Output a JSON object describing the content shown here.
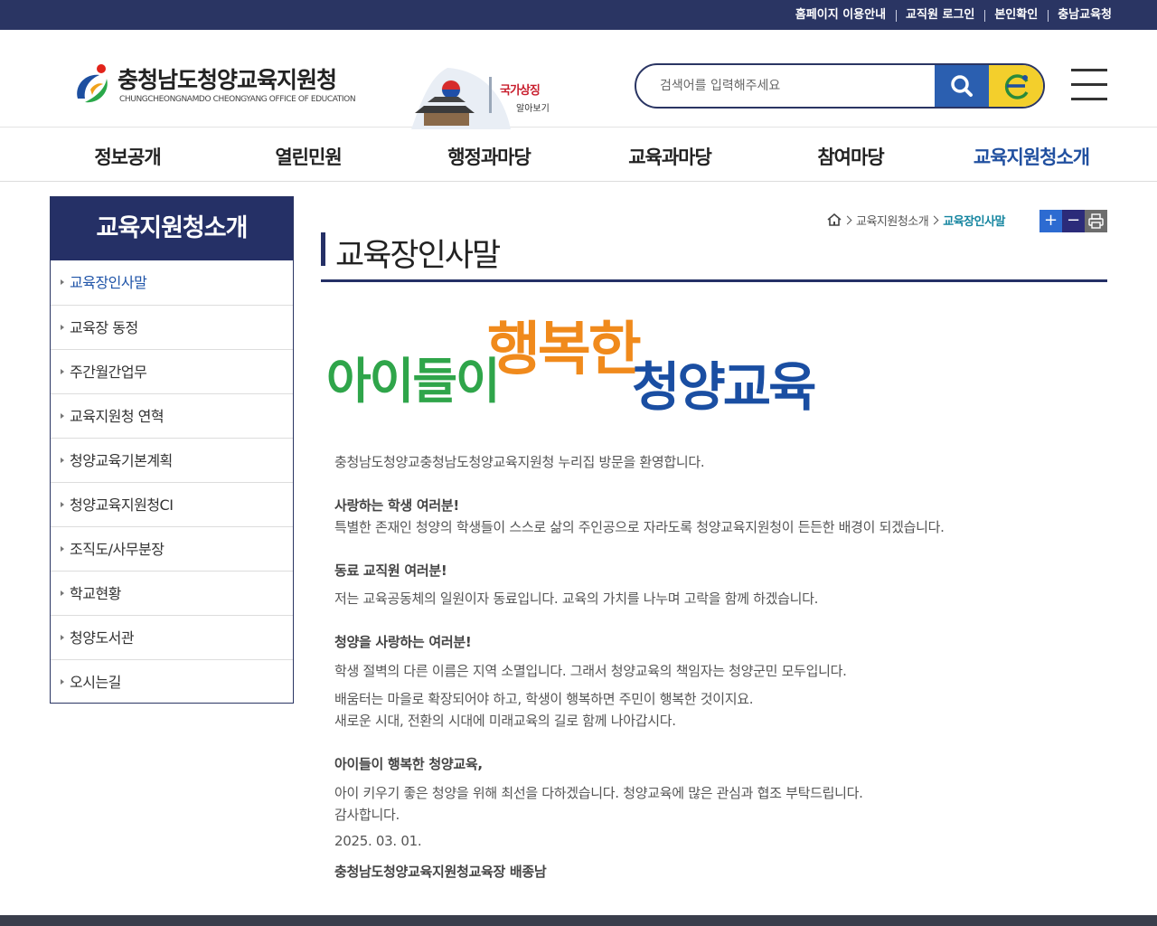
{
  "topbar": {
    "links": [
      "홈페이지 이용안내",
      "교직원 로그인",
      "본인확인",
      "충남교육청"
    ]
  },
  "header": {
    "logo_name": "충청남도청양교육지원청",
    "logo_eng": "CHUNGCHEONGNAMDO CHEONGYANG OFFICE OF EDUCATION",
    "banner_line1": "국가상징",
    "banner_line2": "알아보기",
    "search_placeholder": "검색어를 입력해주세요"
  },
  "gnb": {
    "items": [
      "정보공개",
      "열린민원",
      "행정과마당",
      "교육과마당",
      "참여마당",
      "교육지원청소개"
    ],
    "active_index": 5
  },
  "lnb": {
    "title": "교육지원청소개",
    "items": [
      "교육장인사말",
      "교육장 동정",
      "주간월간업무",
      "교육지원청 연혁",
      "청양교육기본계획",
      "청양교육지원청CI",
      "조직도/사무분장",
      "학교현황",
      "청양도서관",
      "오시는길"
    ],
    "active_index": 0
  },
  "location": {
    "level1": "교육지원청소개",
    "current": "교육장인사말"
  },
  "tools": {
    "plus": "+",
    "minus": "−"
  },
  "page": {
    "title": "교육장인사말",
    "slogan_part1": "아이들이",
    "slogan_part2": "행복한",
    "slogan_part3": "청양교육"
  },
  "greeting": {
    "l1": "충청남도청양교충청남도청양교육지원청 누리집 방문을 환영합니다.",
    "h1": "사랑하는 학생 여러분!",
    "l2": "특별한 존재인 청양의 학생들이 스스로 삶의 주인공으로 자라도록 청양교육지원청이 든든한 배경이 되겠습니다.",
    "h2": "동료 교직원 여러분!",
    "l3": "저는 교육공동체의 일원이자 동료입니다. 교육의 가치를 나누며 고락을 함께 하겠습니다.",
    "h3": "청양을 사랑하는 여러분!",
    "l4": "학생 절벽의 다른 이름은 지역 소멸입니다. 그래서 청양교육의 책임자는 청양군민 모두입니다.",
    "l5": "배움터는 마을로 확장되어야 하고, 학생이 행복하면 주민이 행복한 것이지요.",
    "l6": "새로운 시대, 전환의 시대에 미래교육의 길로 함께 나아갑시다.",
    "h4": "아이들이 행복한 청양교육,",
    "l7": "아이 키우기 좋은 청양을 위해 최선을 다하겠습니다. 청양교육에 많은 관심과 협조 부탁드립니다.",
    "l8": "감사합니다.",
    "date": "2025. 03. 01.",
    "signature": "충청남도청양교육지원청교육장 배종남"
  }
}
